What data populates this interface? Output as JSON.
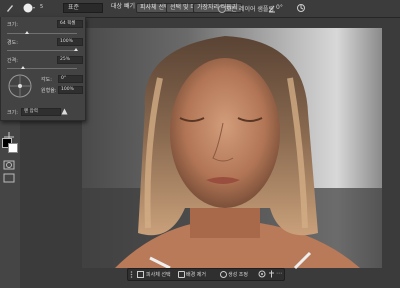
{
  "options_bar": {
    "size_value": "5",
    "mode_label": "표준",
    "sample_all": "모든 레이어 샘플링",
    "subtract_btn": "대상 빼기",
    "select_subject": "피사체 선택",
    "select_and_mask": "선택 및 마스크...",
    "refine_edge": "가장자리 다듬기",
    "angle_value": "0°"
  },
  "brush_panel": {
    "size_label": "크기:",
    "size_value": "64 픽셀",
    "hardness_label": "경도:",
    "hardness_value": "100%",
    "spacing_label": "간격:",
    "spacing_value": "25%",
    "angle_label": "각도:",
    "angle_value": "0°",
    "roundness_label": "원형율:",
    "roundness_value": "100%",
    "pressure_label": "크기:",
    "pressure_value": "펜 압력"
  },
  "context_bar": {
    "select_subject": "피사체 선택",
    "remove_bg": "배경 제거",
    "generate": "생성 조정"
  }
}
